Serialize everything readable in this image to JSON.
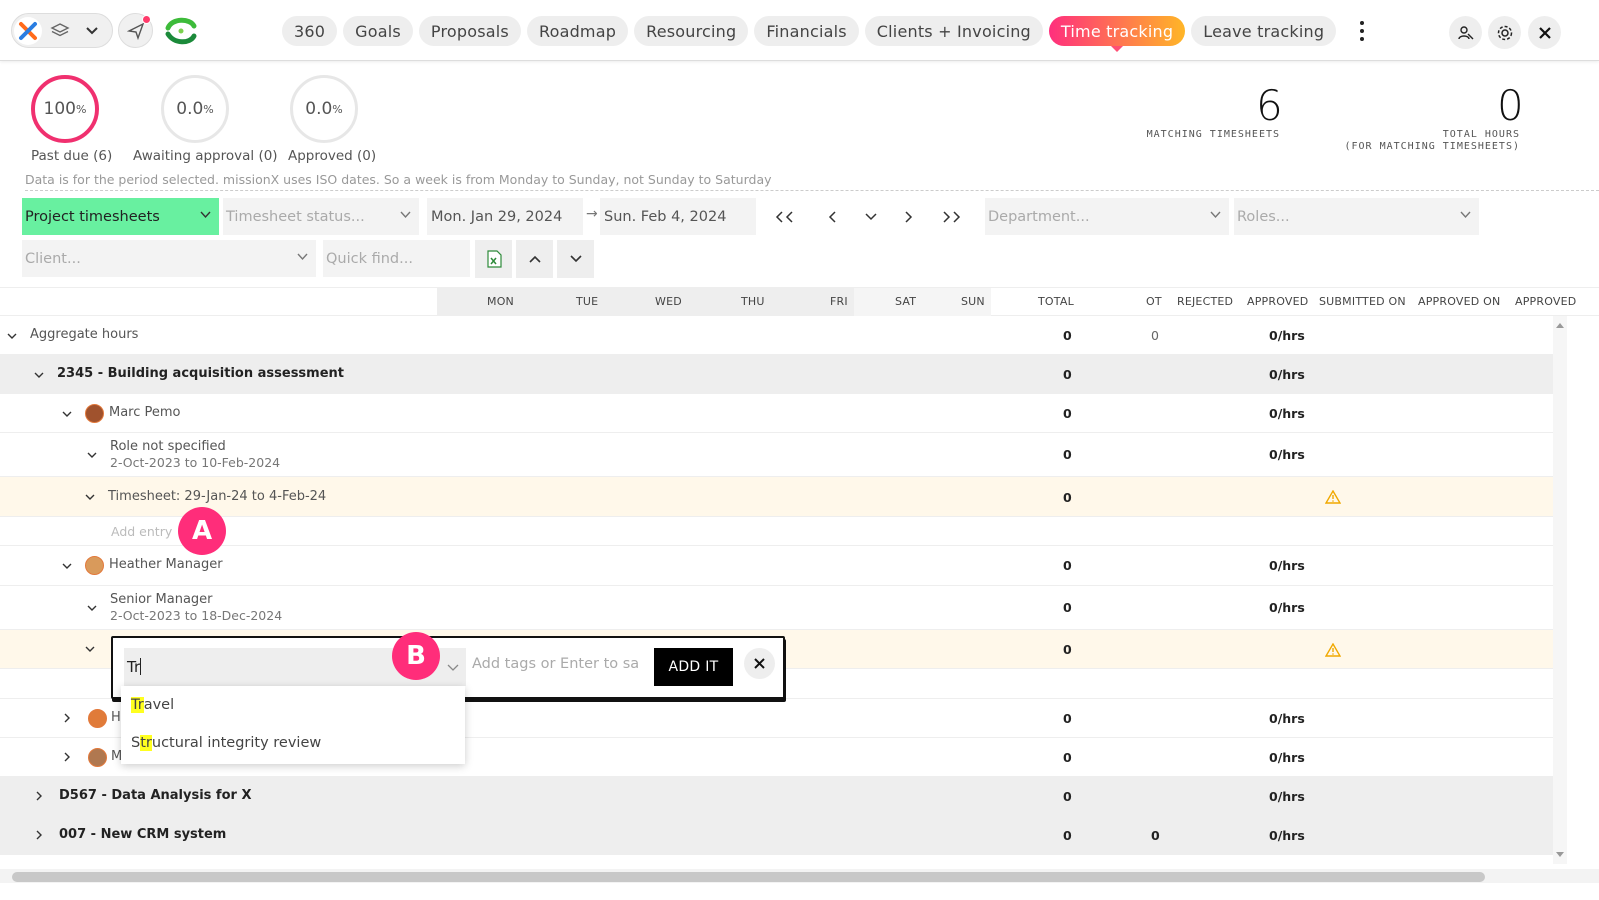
{
  "nav": {
    "tabs": [
      {
        "label": "360"
      },
      {
        "label": "Goals"
      },
      {
        "label": "Proposals"
      },
      {
        "label": "Roadmap"
      },
      {
        "label": "Resourcing"
      },
      {
        "label": "Financials"
      },
      {
        "label": "Clients + Invoicing"
      },
      {
        "label": "Time tracking",
        "active": true
      },
      {
        "label": "Leave tracking"
      }
    ]
  },
  "summary": {
    "past_due": {
      "value": "100",
      "unit": "%",
      "label": "Past due (6)"
    },
    "awaiting": {
      "value": "0.0",
      "unit": "%",
      "label": "Awaiting approval (0)"
    },
    "approved": {
      "value": "0.0",
      "unit": "%",
      "label": "Approved (0)"
    },
    "matching": {
      "value": "6",
      "label": "MATCHING TIMESHEETS"
    },
    "total_hours": {
      "value": "0",
      "label_1": "TOTAL HOURS",
      "label_2": "(FOR MATCHING TIMESHEETS)"
    },
    "note": "Data is for the period selected. missionX uses ISO dates. So a week is from Monday to Sunday, not Sunday to Saturday"
  },
  "filters": {
    "view": "Project timesheets",
    "status_placeholder": "Timesheet status...",
    "date_from": "Mon. Jan 29, 2024",
    "date_arrow": "→",
    "date_to": "Sun. Feb 4, 2024",
    "department_placeholder": "Department...",
    "roles_placeholder": "Roles...",
    "client_placeholder": "Client...",
    "quick_find_placeholder": "Quick find..."
  },
  "table": {
    "columns": [
      "MON",
      "TUE",
      "WED",
      "THU",
      "FRI",
      "SAT",
      "SUN",
      "TOTAL",
      "OT",
      "REJECTED",
      "APPROVED",
      "SUBMITTED ON",
      "APPROVED ON",
      "APPROVED"
    ],
    "rows": {
      "aggregate": {
        "label": "Aggregate hours",
        "total": "0",
        "ot": "0",
        "approved": "0/hrs"
      },
      "proj1": {
        "label": "2345 - Building acquisition assessment",
        "total": "0",
        "approved": "0/hrs"
      },
      "marc": {
        "label": "Marc Pemo",
        "total": "0",
        "approved": "0/hrs"
      },
      "marc_role": {
        "label": "Role not specified",
        "dates": "2-Oct-2023 to 10-Feb-2024",
        "total": "0",
        "approved": "0/hrs"
      },
      "marc_ts": {
        "label": "Timesheet: 29-Jan-24  to  4-Feb-24",
        "total": "0"
      },
      "add_entry": {
        "label": "Add entry"
      },
      "heather": {
        "label": "Heather Manager",
        "total": "0",
        "approved": "0/hrs"
      },
      "heather_role": {
        "label": "Senior Manager",
        "dates": "2-Oct-2023 to 18-Dec-2024",
        "total": "0",
        "approved": "0/hrs"
      },
      "heather_ts": {
        "total": "0"
      },
      "person3": {
        "initial": "H",
        "total": "0",
        "approved": "0/hrs"
      },
      "person4": {
        "initial": "M",
        "total": "0",
        "approved": "0/hrs"
      },
      "proj2": {
        "label": "D567 - Data Analysis for X",
        "total": "0",
        "approved": "0/hrs"
      },
      "proj3": {
        "label": "007 - New CRM system",
        "total": "0",
        "ot": "0",
        "approved": "0/hrs"
      }
    }
  },
  "popup": {
    "input_value": "Tr",
    "tags_placeholder": "Add tags or Enter to save",
    "add_button": "ADD IT",
    "options": [
      {
        "pre": "",
        "hl": "Tr",
        "post": "avel"
      },
      {
        "pre": "S",
        "hl": "tr",
        "post": "uctural integrity review"
      }
    ]
  },
  "annotations": {
    "a": "A",
    "b": "B"
  },
  "colors": {
    "accent_start": "#ff2f7d",
    "accent_end": "#ffb627",
    "green": "#68f0a0",
    "badge": "#ff2d7a"
  }
}
